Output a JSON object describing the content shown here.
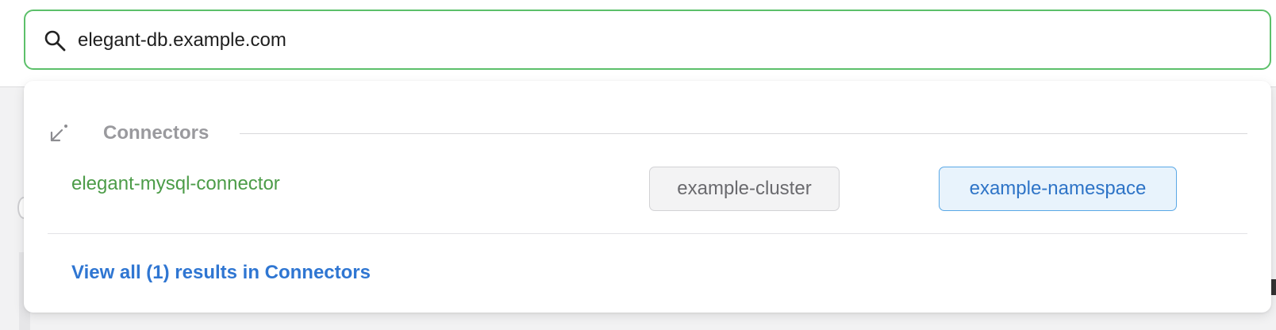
{
  "search": {
    "value": "elegant-db.example.com",
    "icon": "search-icon"
  },
  "dropdown": {
    "section": {
      "icon": "arrow-down-left-icon",
      "title": "Connectors"
    },
    "results": [
      {
        "name": "elegant-mysql-connector",
        "cluster": "example-cluster",
        "namespace": "example-namespace"
      }
    ],
    "view_all": "View all (1) results in Connectors"
  },
  "colors": {
    "focus_border": "#5cc06a",
    "result_name": "#4c9c48",
    "link": "#2f76d2",
    "namespace_tag_border": "#5aa8e6"
  }
}
